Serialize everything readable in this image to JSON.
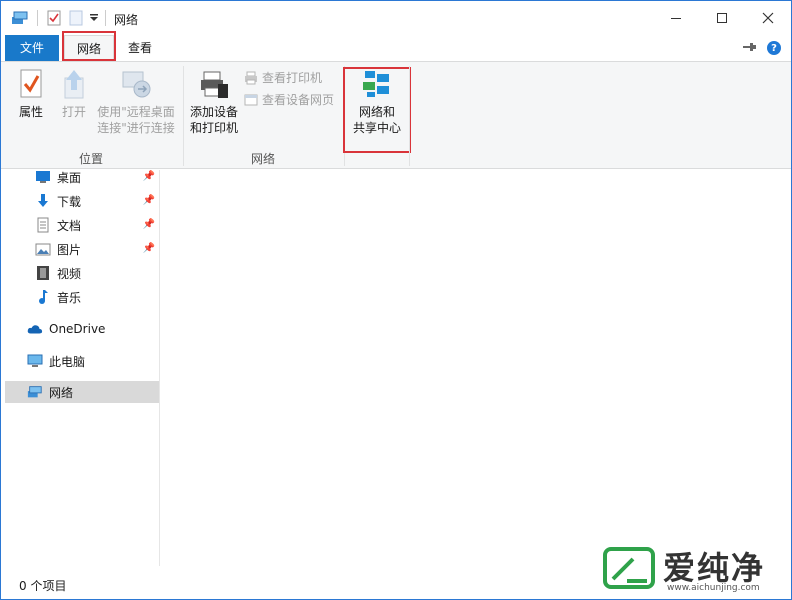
{
  "window": {
    "title": "网络"
  },
  "tabs": {
    "file": "文件",
    "network": "网络",
    "view": "查看"
  },
  "ribbon": {
    "location_group": {
      "label": "位置",
      "properties": "属性",
      "open": "打开",
      "remote_desktop_line1": "使用\"远程桌面",
      "remote_desktop_line2": "连接\"进行连接"
    },
    "network_group": {
      "label": "网络",
      "add_device_line1": "添加设备",
      "add_device_line2": "和打印机",
      "view_printers": "查看打印机",
      "view_device_webpage": "查看设备网页"
    },
    "sharing": {
      "line1": "网络和",
      "line2": "共享中心"
    }
  },
  "nav": {
    "items": [
      {
        "label": "桌面"
      },
      {
        "label": "下载"
      },
      {
        "label": "文档"
      },
      {
        "label": "图片"
      },
      {
        "label": "视频"
      },
      {
        "label": "音乐"
      },
      {
        "label": "OneDrive"
      },
      {
        "label": "此电脑"
      },
      {
        "label": "网络"
      }
    ]
  },
  "status": {
    "items_text": "0 个项目"
  },
  "watermark": {
    "brand": "爱纯净",
    "url": "www.aichunjing.com"
  },
  "colors": {
    "accent": "#1979ca",
    "highlight_box": "#d9343a",
    "watermark_green": "#2fa24a"
  }
}
